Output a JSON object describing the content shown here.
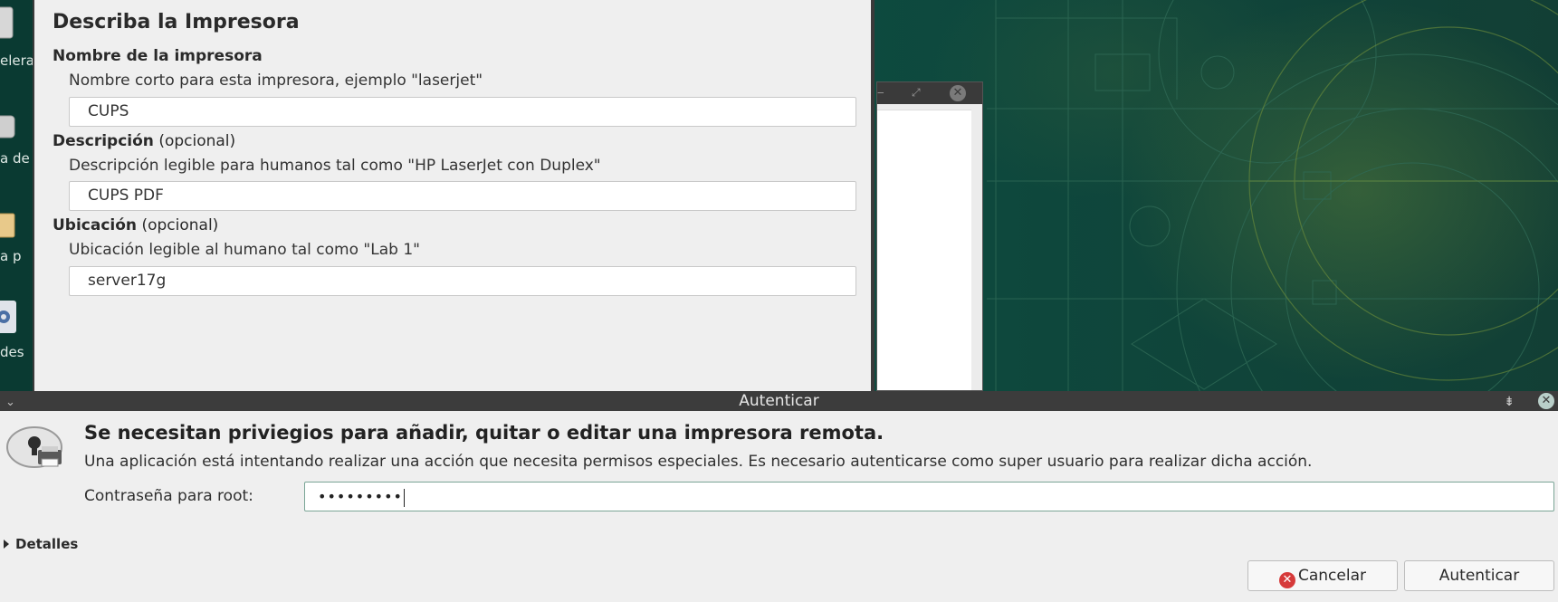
{
  "desktop": {
    "icons": [
      {
        "label": "elera",
        "icon": "trash-icon"
      },
      {
        "label": "a de",
        "icon": "drive-icon"
      },
      {
        "label": "a p",
        "icon": "folder-icon"
      },
      {
        "label": "des",
        "icon": "gear-icon"
      }
    ]
  },
  "printer_dialog": {
    "title": "Describa la Impresora",
    "name_section": {
      "heading": "Nombre de la impresora",
      "hint": "Nombre corto para esta impresora, ejemplo \"laserjet\"",
      "value": "CUPS"
    },
    "description_section": {
      "heading": "Descripción",
      "optional": "(opcional)",
      "hint": "Descripción legible para humanos tal como \"HP LaserJet con Duplex\"",
      "value": "CUPS PDF"
    },
    "location_section": {
      "heading": "Ubicación",
      "optional": "(opcional)",
      "hint": "Ubicación legible al humano tal como \"Lab 1\"",
      "value": "server17g"
    }
  },
  "auth_dialog": {
    "title": "Autenticar",
    "heading": "Se necesitan priviegios para añadir, quitar o editar una impresora remota.",
    "message": "Una aplicación está intentando realizar una acción que necesita permisos especiales. Es necesario autenticarse como super usuario para realizar dicha acción.",
    "password_label": "Contraseña para root:",
    "password_masked": "•••••••••",
    "details_label": "Detalles",
    "cancel_label": "Cancelar",
    "authenticate_label": "Autenticar"
  }
}
